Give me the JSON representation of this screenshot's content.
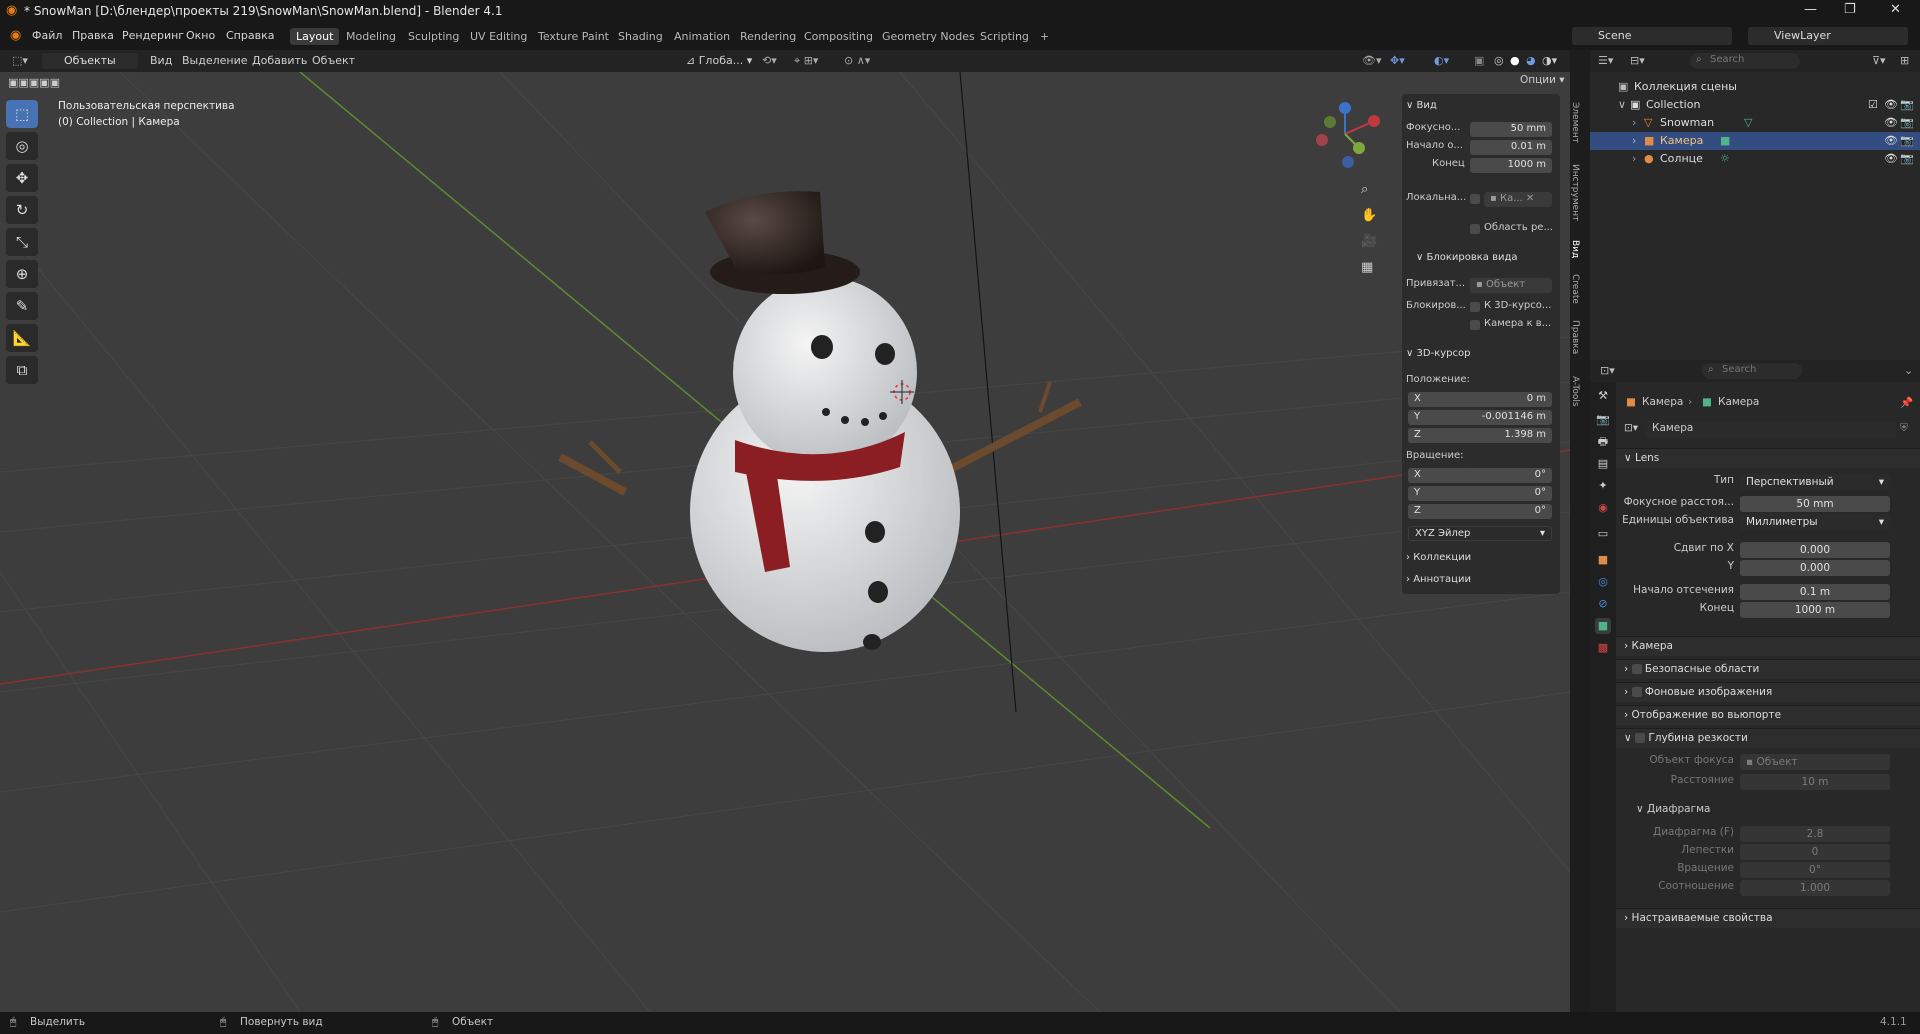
{
  "titlebar": {
    "title": "* SnowMan [D:\\блендер\\проекты 219\\SnowMan\\SnowMan.blend] - Blender 4.1"
  },
  "menu": [
    "Файл",
    "Правка",
    "Рендеринг",
    "Окно",
    "Справка"
  ],
  "workspaces": [
    "Layout",
    "Modeling",
    "Sculpting",
    "UV Editing",
    "Texture Paint",
    "Shading",
    "Animation",
    "Rendering",
    "Compositing",
    "Geometry Nodes",
    "Scripting",
    "+"
  ],
  "scene": {
    "name": "Scene",
    "viewlayer": "ViewLayer"
  },
  "viewport_header": {
    "mode": "Объекты",
    "menus": [
      "Вид",
      "Выделение",
      "Добавить",
      "Объект"
    ],
    "orientation": "Глоба...",
    "options": "Опции"
  },
  "viewport": {
    "line1": "Пользовательская перспектива",
    "line2": "(0) Collection | Камера"
  },
  "npanel": {
    "view_title": "Вид",
    "focal_label": "Фокусно...",
    "focal_value": "50 mm",
    "clip_start_label": "Начало о...",
    "clip_start_value": "0.01 m",
    "clip_end_label": "Конец",
    "clip_end_value": "1000 m",
    "local_label": "Локальна...",
    "local_value": "Ка...",
    "region_label": "Область ре...",
    "lock_title": "Блокировка вида",
    "lock_to_label": "Привязат...",
    "lock_to_placeholder": "Объект",
    "lock_label": "Блокиров...",
    "lock_cursor": "К 3D-курсо...",
    "lock_camera": "Камера к в...",
    "cursor_title": "3D-курсор",
    "location_label": "Положение:",
    "loc": [
      {
        "axis": "X",
        "value": "0 m"
      },
      {
        "axis": "Y",
        "value": "-0.001146 m"
      },
      {
        "axis": "Z",
        "value": "1.398 m"
      }
    ],
    "rotation_label": "Вращение:",
    "rot": [
      {
        "axis": "X",
        "value": "0°"
      },
      {
        "axis": "Y",
        "value": "0°"
      },
      {
        "axis": "Z",
        "value": "0°"
      }
    ],
    "rot_mode": "XYZ Эйлер",
    "collections": "Коллекции",
    "annotations": "Аннотации"
  },
  "ntabs": [
    "Элемент",
    "Инструмент",
    "Вид",
    "Create",
    "Правка",
    "A-Tools"
  ],
  "outliner": {
    "search_placeholder": "Search",
    "root": "Коллекция сцены",
    "collection": "Collection",
    "items": [
      {
        "name": "Snowman",
        "selected": false,
        "icon_color": "#e08c48"
      },
      {
        "name": "Камера",
        "selected": true,
        "icon_color": "#e08c48"
      },
      {
        "name": "Солнце",
        "selected": false,
        "icon_color": "#e08c48"
      }
    ]
  },
  "properties": {
    "search_placeholder": "Search",
    "breadcrumb_1": "Камера",
    "breadcrumb_2": "Камера",
    "datablock": "Камера",
    "lens_title": "Lens",
    "type_label": "Тип",
    "type_value": "Перспективный",
    "focal_label": "Фокусное расстоя...",
    "focal_value": "50 mm",
    "units_label": "Единицы объектива",
    "units_value": "Миллиметры",
    "shiftx_label": "Сдвиг по X",
    "shiftx_value": "0.000",
    "shifty_label": "Y",
    "shifty_value": "0.000",
    "clipstart_label": "Начало отсечения",
    "clipstart_value": "0.1 m",
    "clipend_label": "Конец",
    "clipend_value": "1000 m",
    "sec_camera": "Камера",
    "sec_safe": "Безопасные области",
    "sec_bg": "Фоновые изображения",
    "sec_display": "Отображение во вьюпорте",
    "sec_dof": "Глубина резкости",
    "focus_obj_label": "Объект фокуса",
    "focus_obj_placeholder": "Объект",
    "distance_label": "Расстояние",
    "distance_value": "10 m",
    "aperture_title": "Диафрагма",
    "fstop_label": "Диафрагма (F)",
    "fstop_value": "2.8",
    "blades_label": "Лепестки",
    "blades_value": "0",
    "rotation_label": "Вращение",
    "rotation_value": "0°",
    "ratio_label": "Соотношение",
    "ratio_value": "1.000",
    "custom": "Настраиваемые свойства"
  },
  "statusbar": {
    "select": "Выделить",
    "rotate": "Повернуть вид",
    "object": "Объект",
    "version": "4.1.1"
  },
  "colors": {
    "accent": "#4772b3",
    "selected_row": "#334d80",
    "x_axis": "#c0393f",
    "y_axis": "#7ea83a",
    "z_axis": "#3a73c8"
  }
}
